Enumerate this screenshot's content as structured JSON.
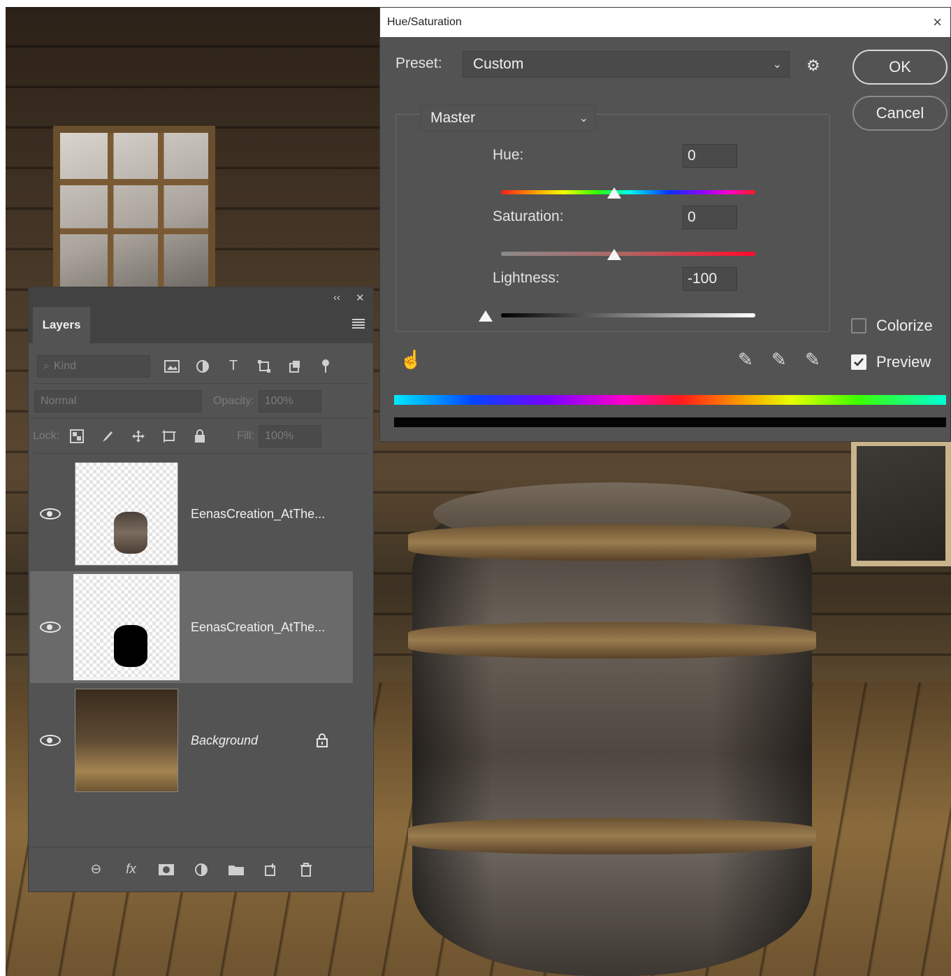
{
  "dialog": {
    "title": "Hue/Saturation",
    "close": "×",
    "preset_label": "Preset:",
    "preset_value": "Custom",
    "channel_value": "Master",
    "ok_label": "OK",
    "cancel_label": "Cancel",
    "hue_label": "Hue:",
    "hue_value": "0",
    "saturation_label": "Saturation:",
    "saturation_value": "0",
    "lightness_label": "Lightness:",
    "lightness_value": "-100",
    "colorize_label": "Colorize",
    "colorize_checked": false,
    "preview_label": "Preview",
    "preview_checked": true
  },
  "layers_panel": {
    "collapse": "‹‹",
    "close": "✕",
    "tab_label": "Layers",
    "filter_kind": "Kind",
    "blend_mode": "Normal",
    "opacity_label": "Opacity:",
    "opacity_value": "100%",
    "lock_label": "Lock:",
    "fill_label": "Fill:",
    "fill_value": "100%",
    "layers": [
      {
        "name": "EenasCreation_AtThe...",
        "visible": true,
        "selected": false
      },
      {
        "name": "EenasCreation_AtThe...",
        "visible": true,
        "selected": true
      },
      {
        "name": "Background",
        "visible": true,
        "selected": false,
        "locked": true
      }
    ]
  },
  "icons": {
    "gear": "⚙",
    "chevron": "⌄",
    "kind_search": "⌕",
    "type": "T",
    "link": "⊖",
    "fx": "fx",
    "trash": "🗑",
    "hand": "☝",
    "eyedropper": "✎"
  }
}
